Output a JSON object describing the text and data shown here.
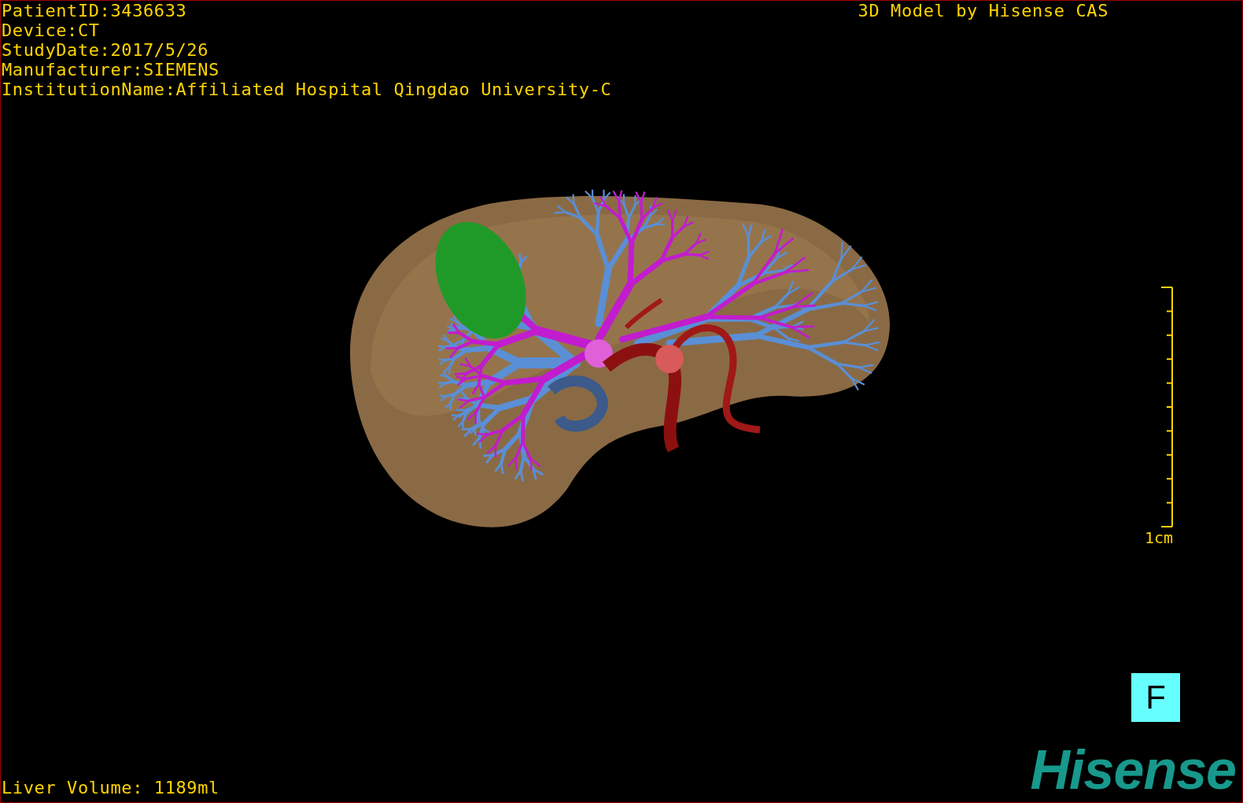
{
  "info_lines": [
    "PatientID:3436633",
    "Device:CT",
    "StudyDate:2017/5/26",
    "Manufacturer:SIEMENS",
    "InstitutionName:Affiliated Hospital Qingdao University-C"
  ],
  "title": "3D Model by Hisense CAS",
  "scale": {
    "label": "1cm"
  },
  "view_orientation": "F",
  "volume": "Liver Volume: 1189ml",
  "logo": "Hisense"
}
